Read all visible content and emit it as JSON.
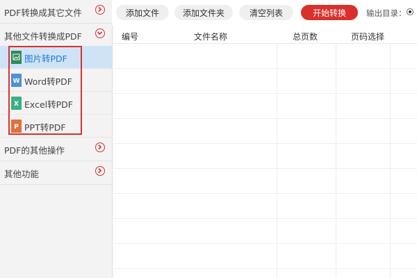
{
  "sidebar": {
    "sections": [
      {
        "label": "PDF转换成其它文件",
        "state": "collapsed"
      },
      {
        "label": "其他文件转换成PDF",
        "state": "expanded"
      },
      {
        "label": "PDF的其他操作",
        "state": "collapsed"
      },
      {
        "label": "其他功能",
        "state": "collapsed"
      }
    ],
    "sub_items": [
      {
        "label": "图片转PDF",
        "icon": "image-file-icon",
        "icon_color": "#2e8b57",
        "active": true
      },
      {
        "label": "Word转PDF",
        "icon": "word-file-icon",
        "icon_color": "#4a90d9",
        "active": false
      },
      {
        "label": "Excel转PDF",
        "icon": "excel-file-icon",
        "icon_color": "#3aaf85",
        "active": false
      },
      {
        "label": "PPT转PDF",
        "icon": "ppt-file-icon",
        "icon_color": "#e2703a",
        "active": false
      }
    ]
  },
  "toolbar": {
    "add_file": "添加文件",
    "add_folder": "添加文件夹",
    "clear_list": "清空列表",
    "start_convert": "开始转换",
    "output_dir_label": "输出目录："
  },
  "table": {
    "columns": [
      "编号",
      "文件名称",
      "总页数",
      "页码选择"
    ]
  },
  "colors": {
    "accent": "#d9302c",
    "active_bg": "#cfe3f7",
    "active_text": "#1a7bd6",
    "sidebar_bg": "#f3f3f3"
  }
}
